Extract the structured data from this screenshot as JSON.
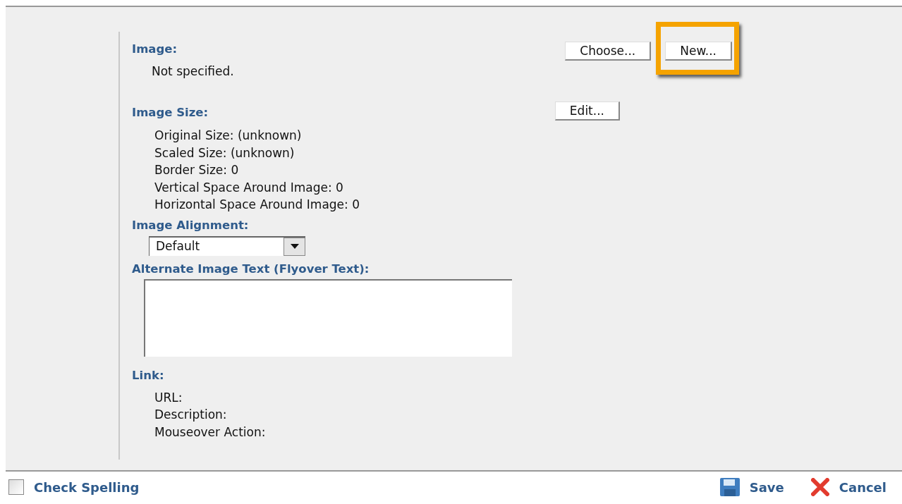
{
  "image": {
    "label": "Image:",
    "value": "Not specified.",
    "buttons": [
      {
        "label": "Choose...",
        "highlighted": false
      },
      {
        "label": "New...",
        "highlighted": true
      }
    ]
  },
  "image_size": {
    "label": "Image Size:",
    "lines": [
      "Original Size: (unknown)",
      "Scaled Size: (unknown)",
      "Border Size: 0",
      "Vertical Space Around Image: 0",
      "Horizontal Space Around Image: 0"
    ],
    "button": "Edit..."
  },
  "alignment": {
    "label": "Image Alignment:",
    "value": "Default"
  },
  "alt_text": {
    "label": "Alternate Image Text (Flyover Text):"
  },
  "link": {
    "label": "Link:",
    "lines": [
      "URL:",
      "Description:",
      "Mouseover Action:"
    ]
  },
  "footer": {
    "check_spelling": {
      "label": "Check Spelling",
      "checked": false
    },
    "save": "Save",
    "cancel": "Cancel"
  }
}
